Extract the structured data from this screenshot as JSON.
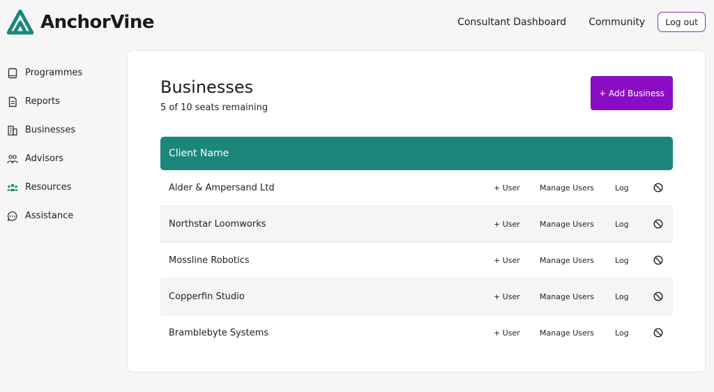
{
  "brand": {
    "name": "AnchorVine",
    "accent": "#1a877a"
  },
  "topnav": {
    "items": [
      "Consultant Dashboard",
      "Community"
    ],
    "logout": "Log out"
  },
  "sidebar": {
    "items": [
      {
        "label": "Programmes",
        "icon": "book-icon"
      },
      {
        "label": "Reports",
        "icon": "document-icon"
      },
      {
        "label": "Businesses",
        "icon": "building-icon"
      },
      {
        "label": "Advisors",
        "icon": "people-icon"
      },
      {
        "label": "Resources",
        "icon": "group-icon"
      },
      {
        "label": "Assistance",
        "icon": "chat-bubble-icon"
      }
    ]
  },
  "main": {
    "title": "Businesses",
    "seats": "5 of 10 seats remaining",
    "add_button": "+ Add Business",
    "add_button_color": "#8a0cc2",
    "table": {
      "header": "Client Name",
      "actions": {
        "add_user": "+ User",
        "manage_users": "Manage Users",
        "log": "Log"
      },
      "rows": [
        {
          "name": "Alder & Ampersand Ltd"
        },
        {
          "name": "Northstar Loomworks"
        },
        {
          "name": "Mossline Robotics"
        },
        {
          "name": "Copperfin Studio"
        },
        {
          "name": "Bramblebyte Systems"
        }
      ]
    }
  }
}
